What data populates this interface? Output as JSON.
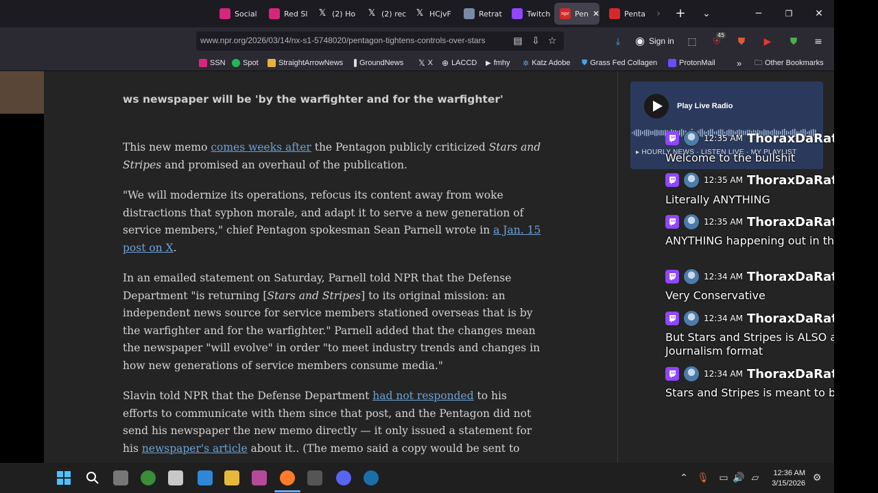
{
  "browser": {
    "tabs": [
      {
        "label": "Social",
        "color": "#d6277c"
      },
      {
        "label": "Red Sl",
        "color": "#d6277c"
      },
      {
        "label": "(2) Ho",
        "color": "#000000"
      },
      {
        "label": "(2) rec",
        "color": "#000000"
      },
      {
        "label": "HCjvF",
        "color": "#000000"
      },
      {
        "label": "Retrat",
        "color": "#7a8aa6"
      },
      {
        "label": "Twitch",
        "color": "#9146ff"
      },
      {
        "label": "Pen",
        "color": "#d62828",
        "active": true
      },
      {
        "label": "Penta",
        "color": "#d62828"
      }
    ],
    "url": "www.npr.org/2026/03/14/nx-s1-5748020/pentagon-tightens-controls-over-stars",
    "sign_in": "Sign in",
    "extension_badge": "45",
    "bookmarks": [
      {
        "label": "SSN"
      },
      {
        "label": "Spot"
      },
      {
        "label": "StraightArrowNews"
      },
      {
        "label": "GroundNews"
      },
      {
        "label": "X"
      },
      {
        "label": "LACCD"
      },
      {
        "label": "fmhy"
      },
      {
        "label": "Katz Adobe"
      },
      {
        "label": "Grass Fed Collagen"
      },
      {
        "label": "ProtonMail"
      }
    ],
    "other_bookmarks": "Other Bookmarks"
  },
  "article": {
    "heading_fragment": "ws newspaper will be 'by the warfighter and for the warfighter'",
    "p1": {
      "before": "This new memo ",
      "link": "comes weeks after",
      "after_a": " the Pentagon publicly criticized ",
      "em": "Stars and Stripes",
      "after_b": " and promised an overhaul of the publication."
    },
    "p2": {
      "text": "\"We will modernize its operations, refocus its content away from woke distractions that syphon morale, and adapt it to serve a new generation of service members,\" chief Pentagon spokesman Sean Parnell wrote in ",
      "link": "a Jan. 15 post on X",
      "after": "."
    },
    "p3": {
      "before": "In an emailed statement on Saturday, Parnell told NPR that the Defense Department \"is returning [",
      "em": "Stars and Stripes",
      "after": "] to its original mission: an independent news source for service members stationed overseas that is by the warfighter and for the warfighter.\" Parnell added that the changes mean the newspaper \"will evolve\" in order \"to meet industry trends and changes in how new generations of service members consume media.\""
    },
    "p4": {
      "before": "Slavin told NPR that the Defense Department ",
      "link": "had not responded",
      "middle": " to his efforts to communicate with them since that post, and the Pentagon did not send his newspaper the new memo directly — it only issued a statement for his ",
      "link2": "newspaper's article",
      "after": " about it.. (The memo said a copy would be sent to"
    }
  },
  "radio": {
    "label": "Play Live Radio",
    "links": "▸ HOURLY NEWS  ·  LISTEN LIVE  ·  MY PLAYLIST"
  },
  "chat": [
    {
      "time": "12:35 AM",
      "user": "ThoraxDaRat",
      "message": "Welcome to the bullshit"
    },
    {
      "time": "12:35 AM",
      "user": "ThoraxDaRat",
      "message": "Literally ANYTHING"
    },
    {
      "time": "12:35 AM",
      "user": "ThoraxDaRat",
      "message": "ANYTHING happening out in the field"
    },
    {
      "time": "12:34 AM",
      "user": "ThoraxDaRat",
      "message": "Very Conservative"
    },
    {
      "time": "12:34 AM",
      "user": "ThoraxDaRat",
      "message": "But Stars and Stripes is ALSO a Journalism format"
    },
    {
      "time": "12:34 AM",
      "user": "ThoraxDaRat",
      "message": "Stars and Stripes is meant to be"
    }
  ],
  "taskbar": {
    "time": "12:36 AM",
    "date": "3/15/2026"
  }
}
